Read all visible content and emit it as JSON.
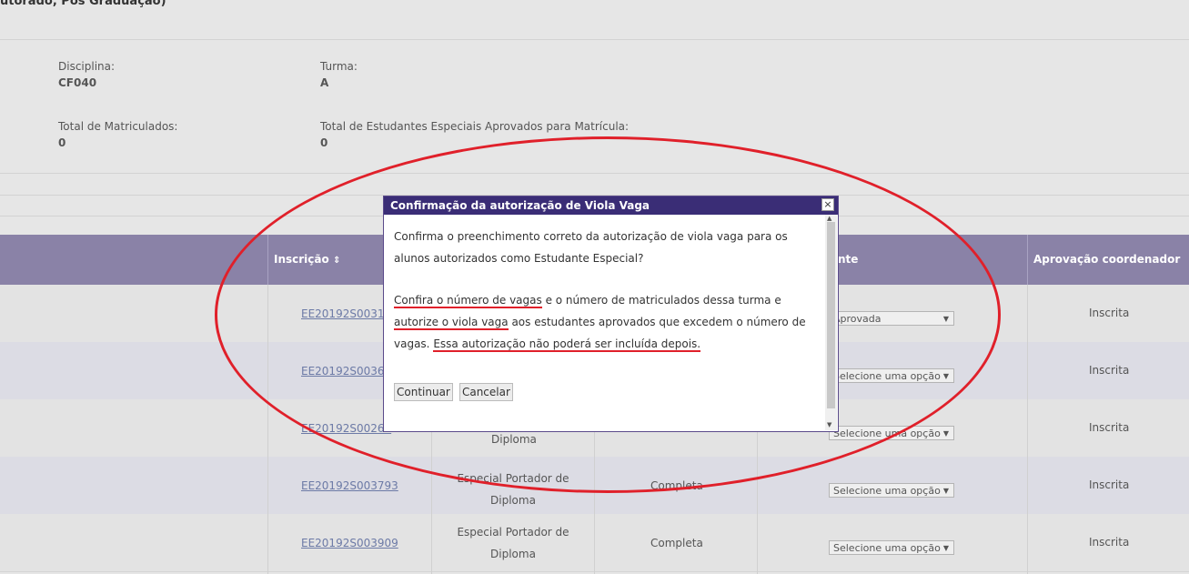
{
  "header": {
    "title_partial": "utorado, Pós Graduação)"
  },
  "info": {
    "disciplina_label": "Disciplina:",
    "disciplina_value": "CF040",
    "turma_label": "Turma:",
    "turma_value": "A",
    "matriculados_label": "Total de Matriculados:",
    "matriculados_value": "0",
    "especiais_label": "Total de Estudantes Especiais Aprovados para Matrícula:",
    "especiais_value": "0"
  },
  "table": {
    "headers": {
      "inscricao": "Inscrição",
      "sort_icon": "⇕",
      "col_hidden_partial": "nte",
      "aprovacao": "Aprovação coordenador"
    },
    "rows": [
      {
        "id": "EE20192S0031",
        "tipo": "",
        "situacao": "",
        "select": "Aprovada",
        "aprov": "Inscrita"
      },
      {
        "id": "EE20192S0036",
        "tipo": "",
        "situacao": "",
        "select": "Selecione uma opção",
        "aprov": "Inscrita"
      },
      {
        "id": "EE20192S00263",
        "tipo": "Diploma",
        "situacao": "",
        "select": "Selecione uma opção",
        "aprov": "Inscrita"
      },
      {
        "id": "EE20192S003793",
        "tipo": "Especial Portador de Diploma",
        "situacao": "Completa",
        "select": "Selecione uma opção",
        "aprov": "Inscrita"
      },
      {
        "id": "EE20192S003909",
        "tipo": "Especial Portador de Diploma",
        "situacao": "Completa",
        "select": "Selecione uma opção",
        "aprov": "Inscrita"
      }
    ]
  },
  "modal": {
    "title": "Confirmação da autorização de Viola Vaga",
    "close": "×",
    "p1": "Confirma o preenchimento correto da autorização de viola vaga para os alunos autorizados como Estudante Especial?",
    "p2_u1": "Confira o número de vagas",
    "p2_a": " e o número de matriculados dessa turma e ",
    "p2_u2": "autorize o viola vaga",
    "p2_b": " aos estudantes aprovados que excedem o número de vagas. ",
    "p2_u3": "Essa autorização não poderá ser incluída depois.",
    "continuar": "Continuar",
    "cancelar": "Cancelar"
  },
  "colors": {
    "header_bg": "#8a82a7",
    "modal_head": "#3a2d76",
    "annotation": "#e0202a",
    "link": "#6c7aa6"
  }
}
